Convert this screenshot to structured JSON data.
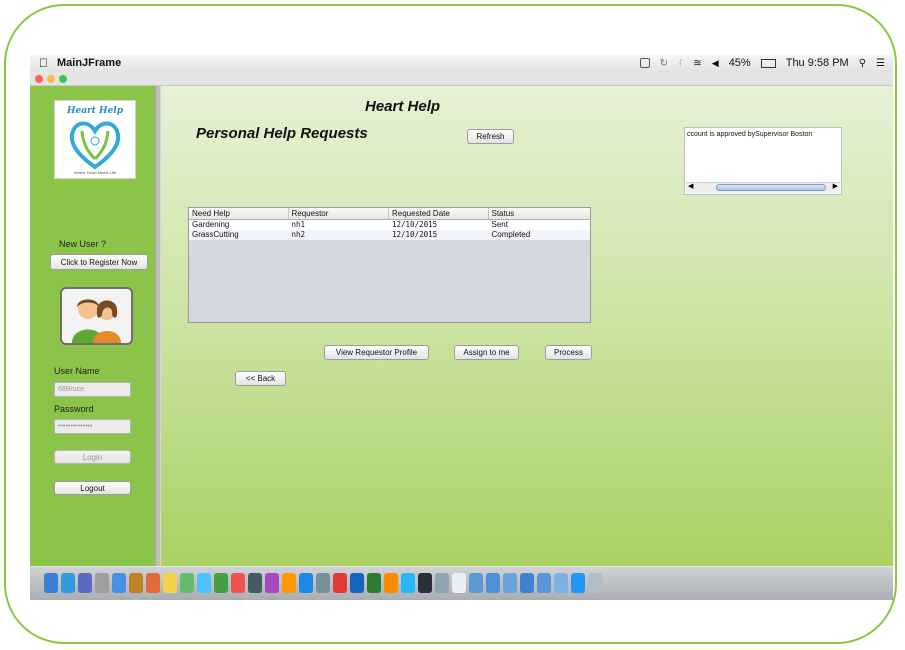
{
  "menubar": {
    "app_name": "MainJFrame",
    "battery": "45%",
    "clock": "Thu 9:58 PM"
  },
  "sidebar": {
    "logo_title": "Heart Help",
    "logo_tagline": "Where Heart Meets Life",
    "new_user_label": "New User ?",
    "register_button": "Click to Register Now",
    "username_label": "User Name",
    "username_value": "68Bruce",
    "password_label": "Password",
    "password_value": "••••••••••••••",
    "login_button": "Login",
    "logout_button": "Logout"
  },
  "main": {
    "title": "Heart Help",
    "subtitle": "Personal Help Requests",
    "refresh_button": "Refresh",
    "message": "ccount is approved bySupervisor Boston",
    "table": {
      "headers": [
        "Need Help",
        "Requestor",
        "Requested Date",
        "Status"
      ],
      "rows": [
        [
          "Gardening",
          "nh1",
          "12/10/2015",
          "Sent"
        ],
        [
          "GrassCutting",
          "nh2",
          "12/10/2015",
          "Completed"
        ]
      ]
    },
    "view_profile_button": "View Requestor Profile",
    "assign_button": "Assign to me",
    "process_button": "Process",
    "back_button": "<< Back"
  },
  "colors": {
    "sidebar_green": "#8cc44a",
    "content_gradient_top": "#e6f1d5",
    "content_gradient_bottom": "#a9d162",
    "frame_border": "#8dc63f"
  }
}
